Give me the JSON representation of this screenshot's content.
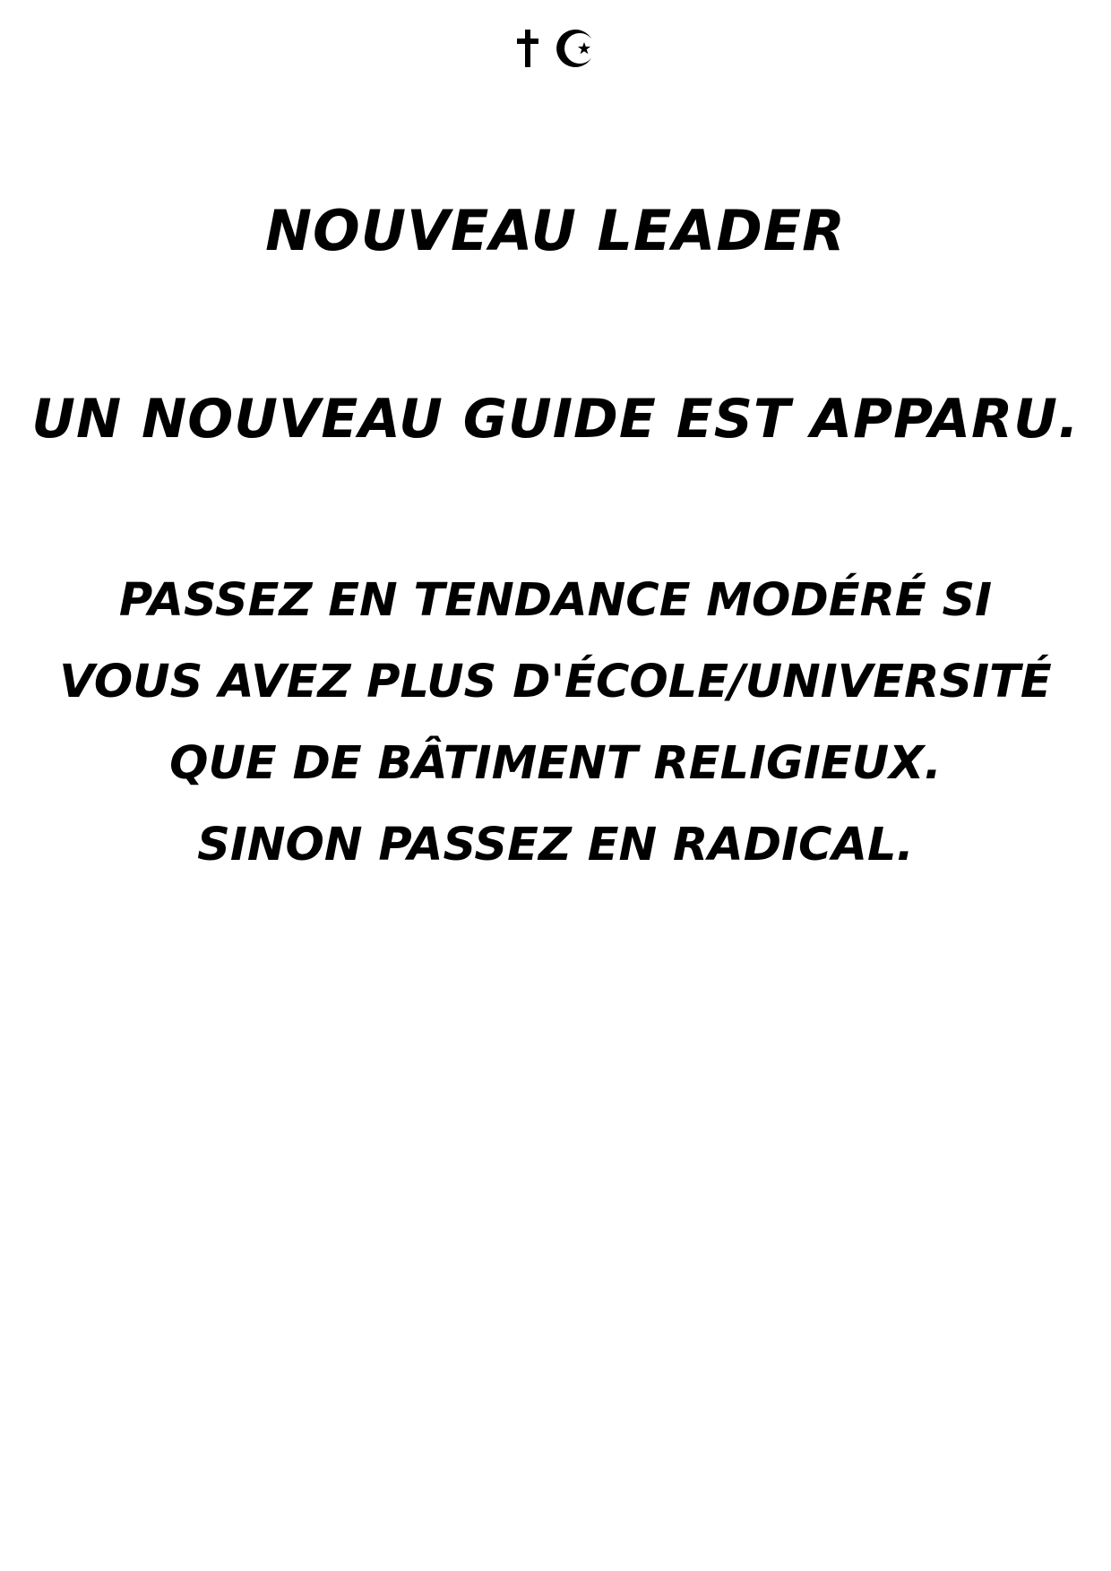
{
  "card": {
    "symbols": [
      "cross-icon",
      "crescent-star-icon"
    ],
    "title": "NOUVEAU LEADER",
    "intro": "UN NOUVEAU GUIDE EST APPARU.",
    "rules": [
      "PASSEZ EN TENDANCE MODÉRÉ SI",
      "VOUS AVEZ PLUS D'ÉCOLE/UNIVERSITÉ",
      "QUE DE BÂTIMENT RELIGIEUX.",
      "SINON PASSEZ EN RADICAL."
    ],
    "colors": {
      "background": "#ffffff",
      "text": "#000000"
    }
  }
}
